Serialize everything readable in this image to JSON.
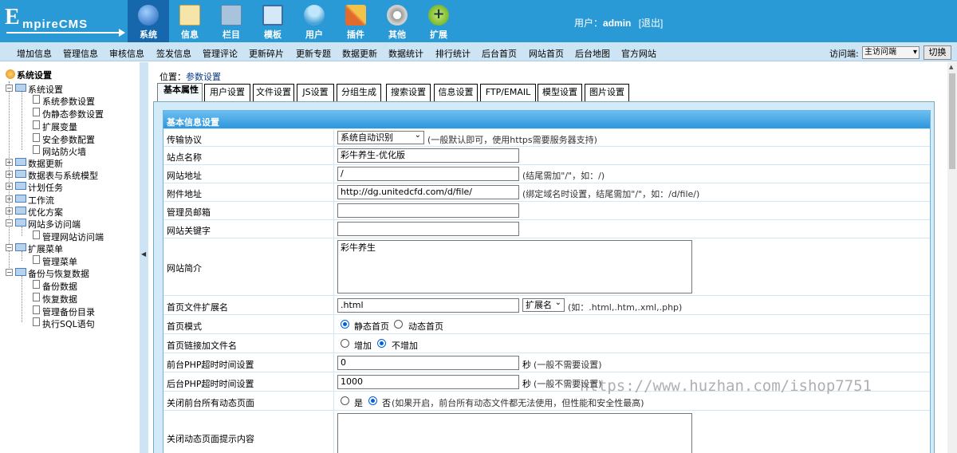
{
  "header": {
    "logo_text": "EmpireCMS",
    "logo_e": "E",
    "logo_rest": "mpireCMS",
    "nav": [
      {
        "label": "系统",
        "icon": "globe-icon",
        "color": "#3b7fd1"
      },
      {
        "label": "信息",
        "icon": "notepad-icon",
        "color": "#f3d27a"
      },
      {
        "label": "栏目",
        "icon": "folder-icon",
        "color": "#9bb7d1"
      },
      {
        "label": "模板",
        "icon": "window-icon",
        "color": "#b9d6f0"
      },
      {
        "label": "用户",
        "icon": "user-icon",
        "color": "#7cc3ea"
      },
      {
        "label": "插件",
        "icon": "tools-icon",
        "color": "#e0a13c"
      },
      {
        "label": "其他",
        "icon": "gear-icon",
        "color": "#b8b8b8"
      },
      {
        "label": "扩展",
        "icon": "plus-icon",
        "color": "#7fc33a"
      }
    ],
    "user_prefix": "用户：",
    "user_name": "admin",
    "logout": "[退出]"
  },
  "menubar": {
    "items": [
      "增加信息",
      "管理信息",
      "审核信息",
      "签发信息",
      "管理评论",
      "更新碎片",
      "更新专题",
      "数据更新",
      "数据统计",
      "排行统计",
      "后台首页",
      "网站首页",
      "后台地图",
      "官方网站"
    ],
    "visit_label": "访问端:",
    "visit_value": "主访问端",
    "switch": "切换"
  },
  "sidebar": {
    "root": "系统设置",
    "items": [
      {
        "label": "系统设置",
        "kind": "folder",
        "open": true
      },
      {
        "label": "系统参数设置",
        "kind": "doc"
      },
      {
        "label": "伪静态参数设置",
        "kind": "doc"
      },
      {
        "label": "扩展变量",
        "kind": "doc"
      },
      {
        "label": "安全参数配置",
        "kind": "doc"
      },
      {
        "label": "网站防火墙",
        "kind": "doc"
      },
      {
        "label": "数据更新",
        "kind": "folder"
      },
      {
        "label": "数据表与系统模型",
        "kind": "folder"
      },
      {
        "label": "计划任务",
        "kind": "folder"
      },
      {
        "label": "工作流",
        "kind": "folder"
      },
      {
        "label": "优化方案",
        "kind": "folder"
      },
      {
        "label": "网站多访问端",
        "kind": "folder",
        "open": true
      },
      {
        "label": "管理网站访问端",
        "kind": "doc"
      },
      {
        "label": "扩展菜单",
        "kind": "folder",
        "open": true
      },
      {
        "label": "管理菜单",
        "kind": "doc"
      },
      {
        "label": "备份与恢复数据",
        "kind": "folder",
        "open": true
      },
      {
        "label": "备份数据",
        "kind": "doc"
      },
      {
        "label": "恢复数据",
        "kind": "doc"
      },
      {
        "label": "管理备份目录",
        "kind": "doc"
      },
      {
        "label": "执行SQL语句",
        "kind": "doc"
      }
    ]
  },
  "main": {
    "pos_label": "位置：",
    "pos_link": "参数设置",
    "tabs": [
      "基本属性",
      "用户设置",
      "文件设置",
      "JS设置",
      "分组生成",
      "搜索设置",
      "信息设置",
      "FTP/EMAIL",
      "模型设置",
      "图片设置"
    ],
    "section": "基本信息设置",
    "rows": [
      {
        "label": "传输协议",
        "select": "系统自动识别",
        "hint": "(一般默认即可，使用https需要服务器支持)"
      },
      {
        "label": "站点名称",
        "value": "彩牛养生-优化版"
      },
      {
        "label": "网站地址",
        "value": "/",
        "hint": "(结尾需加\"/\"，如：/)"
      },
      {
        "label": "附件地址",
        "value": "http://dg.unitedcfd.com/d/file/",
        "hint": "(绑定域名时设置，结尾需加\"/\"，如：/d/file/)"
      },
      {
        "label": "管理员邮箱",
        "value": ""
      },
      {
        "label": "网站关键字",
        "value": ""
      },
      {
        "label": "网站简介",
        "value": "彩牛养生"
      },
      {
        "label": "首页文件扩展名",
        "value": ".html",
        "select": "扩展名",
        "hint": "(如：.html,.htm,.xml,.php)"
      },
      {
        "label": "首页模式",
        "opt1": "静态首页",
        "opt2": "动态首页"
      },
      {
        "label": "首页链接加文件名",
        "opt1": "增加",
        "opt2": "不增加"
      },
      {
        "label": "前台PHP超时时间设置",
        "value": "0",
        "unit": "秒",
        "hint": "(一般不需要设置)"
      },
      {
        "label": "后台PHP超时时间设置",
        "value": "1000",
        "unit": "秒",
        "hint": "(一般不需要设置)"
      },
      {
        "label": "关闭前台所有动态页面",
        "opt1": "是",
        "opt2": "否",
        "hint": "(如果开启，前台所有动态文件都无法使用，但性能和安全性最高)"
      },
      {
        "label": "关闭动态页面提示内容",
        "value": ""
      }
    ]
  },
  "watermark": "https://www.huzhan.com/ishop7751"
}
